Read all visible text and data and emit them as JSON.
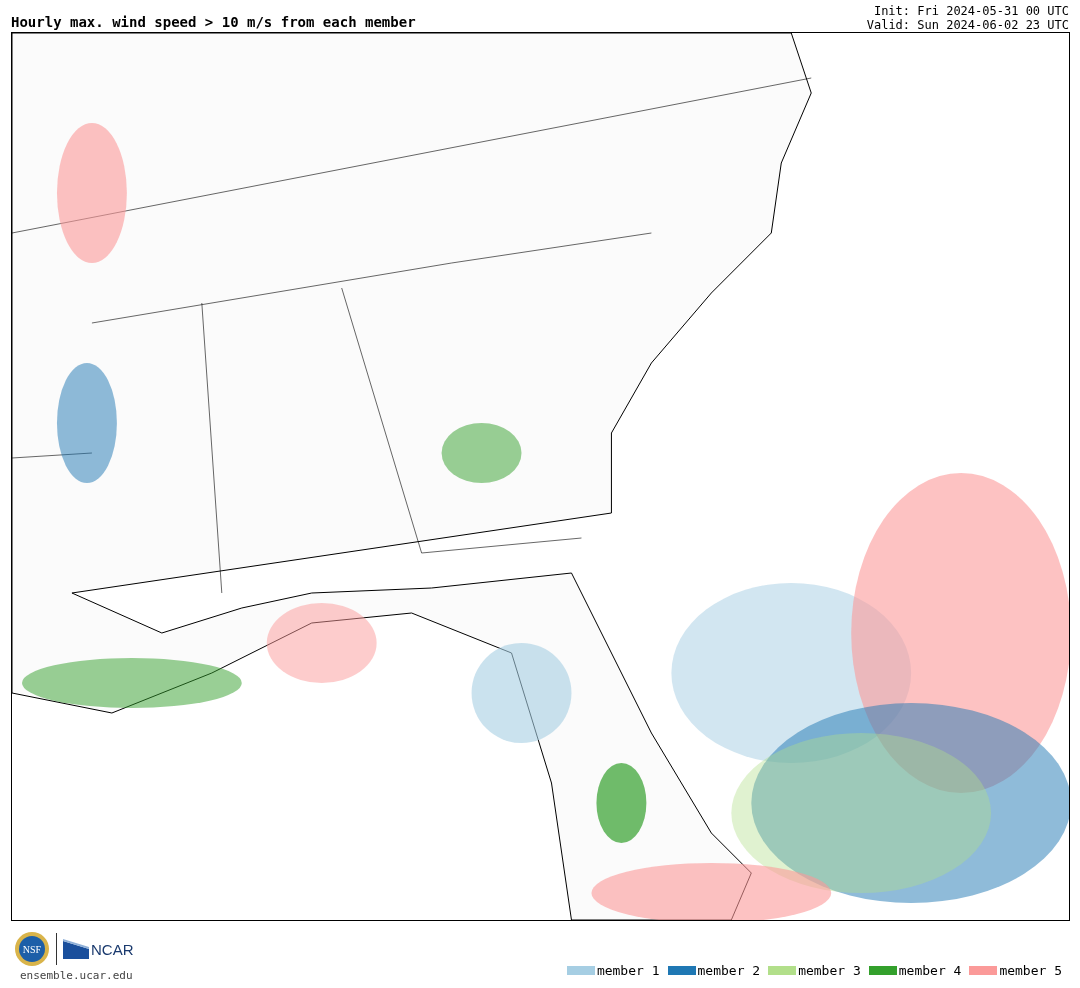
{
  "header": {
    "title": "Hourly max. wind speed > 10 m/s from each member",
    "init": "Init: Fri 2024-05-31 00 UTC",
    "valid": "Valid: Sun 2024-06-02 23 UTC"
  },
  "footer": {
    "logo_nsf": "NSF",
    "logo_ncar": "NCAR",
    "url": "ensemble.ucar.edu"
  },
  "legend": [
    {
      "label": "member 1",
      "color": "#a6cee3"
    },
    {
      "label": "member 2",
      "color": "#1f78b4"
    },
    {
      "label": "member 3",
      "color": "#b2df8a"
    },
    {
      "label": "member 4",
      "color": "#33a02c"
    },
    {
      "label": "member 5",
      "color": "#fb9a99"
    }
  ]
}
